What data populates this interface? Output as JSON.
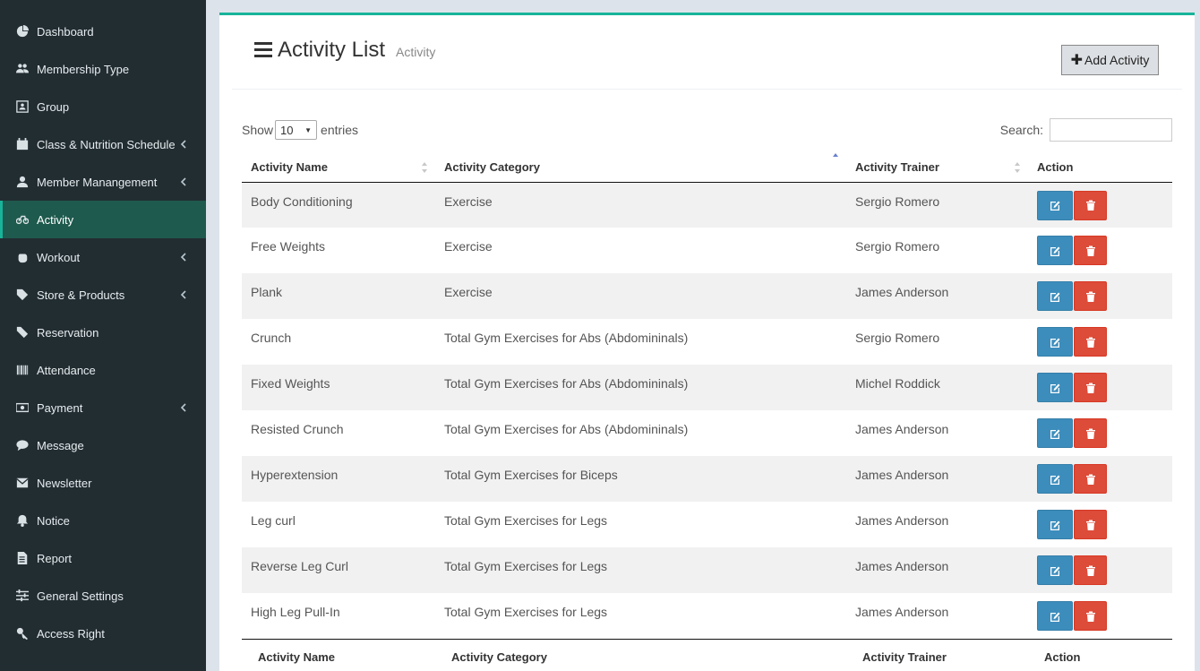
{
  "sidebar": {
    "items": [
      {
        "label": "Dashboard",
        "icon": "dashboard-icon",
        "has_submenu": false
      },
      {
        "label": "Membership Type",
        "icon": "users-icon",
        "has_submenu": false
      },
      {
        "label": "Group",
        "icon": "group-icon",
        "has_submenu": false
      },
      {
        "label": "Class & Nutrition Schedule",
        "icon": "calendar-icon",
        "has_submenu": true
      },
      {
        "label": "Member Manangement",
        "icon": "user-icon",
        "has_submenu": true
      },
      {
        "label": "Activity",
        "icon": "bicycle-icon",
        "has_submenu": false,
        "active": true
      },
      {
        "label": "Workout",
        "icon": "hand-icon",
        "has_submenu": true
      },
      {
        "label": "Store & Products",
        "icon": "tags-icon",
        "has_submenu": true
      },
      {
        "label": "Reservation",
        "icon": "ticket-icon",
        "has_submenu": false
      },
      {
        "label": "Attendance",
        "icon": "barcode-icon",
        "has_submenu": false
      },
      {
        "label": "Payment",
        "icon": "money-icon",
        "has_submenu": true
      },
      {
        "label": "Message",
        "icon": "comment-icon",
        "has_submenu": false
      },
      {
        "label": "Newsletter",
        "icon": "envelope-icon",
        "has_submenu": false
      },
      {
        "label": "Notice",
        "icon": "bell-icon",
        "has_submenu": false
      },
      {
        "label": "Report",
        "icon": "file-icon",
        "has_submenu": false
      },
      {
        "label": "General Settings",
        "icon": "sliders-icon",
        "has_submenu": false
      },
      {
        "label": "Access Right",
        "icon": "key-icon",
        "has_submenu": false
      }
    ]
  },
  "header": {
    "title": "Activity List",
    "subtitle": "Activity",
    "add_button": "Add Activity"
  },
  "controls": {
    "show_label": "Show",
    "page_size": "10",
    "entries_label": "entries",
    "search_label": "Search:",
    "search_value": ""
  },
  "table": {
    "columns": [
      "Activity Name",
      "Activity Category",
      "Activity Trainer",
      "Action"
    ],
    "rows": [
      [
        "Body Conditioning",
        "Exercise",
        "Sergio Romero"
      ],
      [
        "Free Weights",
        "Exercise",
        "Sergio Romero"
      ],
      [
        "Plank",
        "Exercise",
        "James Anderson"
      ],
      [
        "Crunch",
        "Total Gym Exercises for Abs (Abdomininals)",
        "Sergio Romero"
      ],
      [
        "Fixed Weights",
        "Total Gym Exercises for Abs (Abdomininals)",
        "Michel Roddick"
      ],
      [
        "Resisted Crunch",
        "Total Gym Exercises for Abs (Abdomininals)",
        "James Anderson"
      ],
      [
        "Hyperextension",
        "Total Gym Exercises for Biceps",
        "James Anderson"
      ],
      [
        "Leg curl",
        "Total Gym Exercises for Legs",
        "James Anderson"
      ],
      [
        "Reverse Leg Curl",
        "Total Gym Exercises for Legs",
        "James Anderson"
      ],
      [
        "High Leg Pull-In",
        "Total Gym Exercises for Legs",
        "James Anderson"
      ]
    ],
    "footer_columns": [
      "Activity Name",
      "Activity Category",
      "Activity Trainer",
      "Action"
    ],
    "sorted_column": "Activity Category",
    "sort_direction": "ascending"
  },
  "colors": {
    "sidebar_bg": "#222d32",
    "active_bg": "#1e5a4d",
    "accent": "#18b49a",
    "edit_button": "#3c8dbc",
    "delete_button": "#dd4b39"
  }
}
